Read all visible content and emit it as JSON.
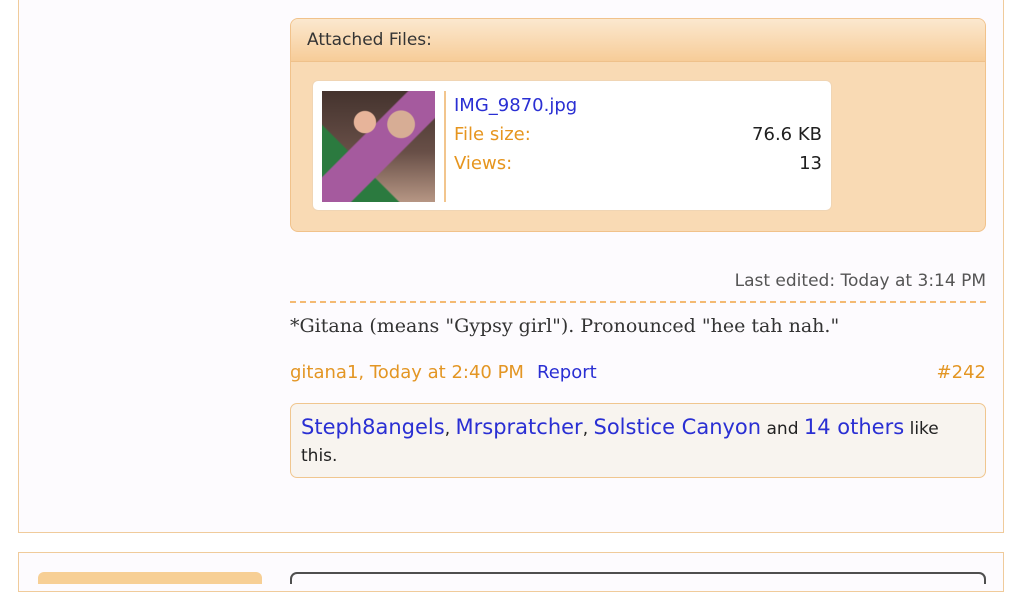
{
  "attachments": {
    "header": "Attached Files:",
    "file": {
      "name": "IMG_9870.jpg",
      "size_label": "File size:",
      "size_value": "76.6 KB",
      "views_label": "Views:",
      "views_value": "13",
      "thumbnail_icon": "photo-thumbnail-icon"
    }
  },
  "post": {
    "last_edited": "Last edited: Today at 3:14 PM",
    "text": "*Gitana (means \"Gypsy girl\"). Pronounced \"hee tah nah.\"",
    "author_time": "gitana1, Today at 2:40 PM",
    "report_label": "Report",
    "post_number": "#242"
  },
  "likes": {
    "users": [
      "Steph8angels",
      "Mrspratcher",
      "Solstice Canyon"
    ],
    "conjunction": "and",
    "others_label": "14 others",
    "suffix": "like this."
  },
  "colors": {
    "accent_orange": "#e39624",
    "link_blue": "#2a2fd3",
    "attachment_bg": "#f9dab4",
    "divider": "#f4ba73"
  }
}
